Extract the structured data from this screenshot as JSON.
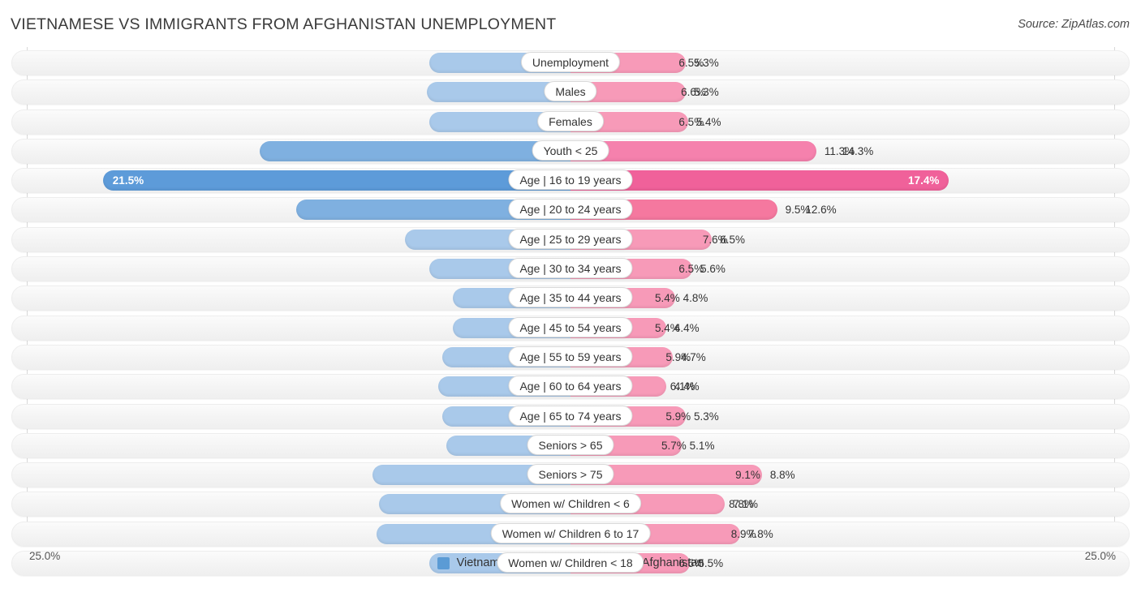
{
  "header": {
    "title": "VIETNAMESE VS IMMIGRANTS FROM AFGHANISTAN UNEMPLOYMENT",
    "source": "Source: ZipAtlas.com"
  },
  "axis": {
    "left_label": "25.0%",
    "right_label": "25.0%",
    "max": 25.0
  },
  "legend": {
    "items": [
      {
        "label": "Vietnamese",
        "color": "#5b9bd5"
      },
      {
        "label": "Immigrants from Afghanistan",
        "color": "#ef5f96"
      }
    ]
  },
  "colors": {
    "blue_light": "#a9c9ea",
    "blue_mid": "#7fb0e0",
    "blue_strong": "#5d9bd9",
    "pink_light": "#f79ab8",
    "pink_mid": "#f5789f",
    "pink_strong": "#f0619a",
    "row_bg": "#f4f4f4",
    "gridline": "#d8d8d8"
  },
  "chart_data": {
    "type": "bar",
    "orientation": "horizontal-diverging",
    "title": "VIETNAMESE VS IMMIGRANTS FROM AFGHANISTAN UNEMPLOYMENT",
    "xlabel": "",
    "ylabel": "",
    "xlim": [
      25.0,
      25.0
    ],
    "grid": true,
    "legend_position": "bottom-center",
    "units": "percent",
    "categories": [
      "Unemployment",
      "Males",
      "Females",
      "Youth < 25",
      "Age | 16 to 19 years",
      "Age | 20 to 24 years",
      "Age | 25 to 29 years",
      "Age | 30 to 34 years",
      "Age | 35 to 44 years",
      "Age | 45 to 54 years",
      "Age | 55 to 59 years",
      "Age | 60 to 64 years",
      "Age | 65 to 74 years",
      "Seniors > 65",
      "Seniors > 75",
      "Women w/ Children < 6",
      "Women w/ Children 6 to 17",
      "Women w/ Children < 18"
    ],
    "series": [
      {
        "name": "Vietnamese",
        "values": [
          6.5,
          6.6,
          6.5,
          14.3,
          21.5,
          12.6,
          7.6,
          6.5,
          5.4,
          5.4,
          5.9,
          6.1,
          5.9,
          5.7,
          9.1,
          8.8,
          8.9,
          6.5
        ]
      },
      {
        "name": "Immigrants from Afghanistan",
        "values": [
          5.3,
          5.3,
          5.4,
          11.3,
          17.4,
          9.5,
          6.5,
          5.6,
          4.8,
          4.4,
          4.7,
          4.4,
          5.3,
          5.1,
          8.8,
          7.1,
          7.8,
          5.5
        ]
      }
    ]
  },
  "rows": [
    {
      "label": "Unemployment",
      "left": "6.5%",
      "right": "5.3%",
      "lv": 6.5,
      "rv": 5.3,
      "style": "norm"
    },
    {
      "label": "Males",
      "left": "6.6%",
      "right": "5.3%",
      "lv": 6.6,
      "rv": 5.3,
      "style": "norm"
    },
    {
      "label": "Females",
      "left": "6.5%",
      "right": "5.4%",
      "lv": 6.5,
      "rv": 5.4,
      "style": "norm"
    },
    {
      "label": "Youth < 25",
      "left": "14.3%",
      "right": "11.3%",
      "lv": 14.3,
      "rv": 11.3,
      "style": "mid2"
    },
    {
      "label": "Age | 16 to 19 years",
      "left": "21.5%",
      "right": "17.4%",
      "lv": 21.5,
      "rv": 17.4,
      "style": "hl"
    },
    {
      "label": "Age | 20 to 24 years",
      "left": "12.6%",
      "right": "9.5%",
      "lv": 12.6,
      "rv": 9.5,
      "style": "mid"
    },
    {
      "label": "Age | 25 to 29 years",
      "left": "7.6%",
      "right": "6.5%",
      "lv": 7.6,
      "rv": 6.5,
      "style": "norm"
    },
    {
      "label": "Age | 30 to 34 years",
      "left": "6.5%",
      "right": "5.6%",
      "lv": 6.5,
      "rv": 5.6,
      "style": "norm"
    },
    {
      "label": "Age | 35 to 44 years",
      "left": "5.4%",
      "right": "4.8%",
      "lv": 5.4,
      "rv": 4.8,
      "style": "norm"
    },
    {
      "label": "Age | 45 to 54 years",
      "left": "5.4%",
      "right": "4.4%",
      "lv": 5.4,
      "rv": 4.4,
      "style": "norm"
    },
    {
      "label": "Age | 55 to 59 years",
      "left": "5.9%",
      "right": "4.7%",
      "lv": 5.9,
      "rv": 4.7,
      "style": "norm"
    },
    {
      "label": "Age | 60 to 64 years",
      "left": "6.1%",
      "right": "4.4%",
      "lv": 6.1,
      "rv": 4.4,
      "style": "norm"
    },
    {
      "label": "Age | 65 to 74 years",
      "left": "5.9%",
      "right": "5.3%",
      "lv": 5.9,
      "rv": 5.3,
      "style": "norm"
    },
    {
      "label": "Seniors > 65",
      "left": "5.7%",
      "right": "5.1%",
      "lv": 5.7,
      "rv": 5.1,
      "style": "norm"
    },
    {
      "label": "Seniors > 75",
      "left": "9.1%",
      "right": "8.8%",
      "lv": 9.1,
      "rv": 8.8,
      "style": "norm"
    },
    {
      "label": "Women w/ Children < 6",
      "left": "8.8%",
      "right": "7.1%",
      "lv": 8.8,
      "rv": 7.1,
      "style": "norm"
    },
    {
      "label": "Women w/ Children 6 to 17",
      "left": "8.9%",
      "right": "7.8%",
      "lv": 8.9,
      "rv": 7.8,
      "style": "norm"
    },
    {
      "label": "Women w/ Children < 18",
      "left": "6.5%",
      "right": "5.5%",
      "lv": 6.5,
      "rv": 5.5,
      "style": "norm"
    }
  ]
}
